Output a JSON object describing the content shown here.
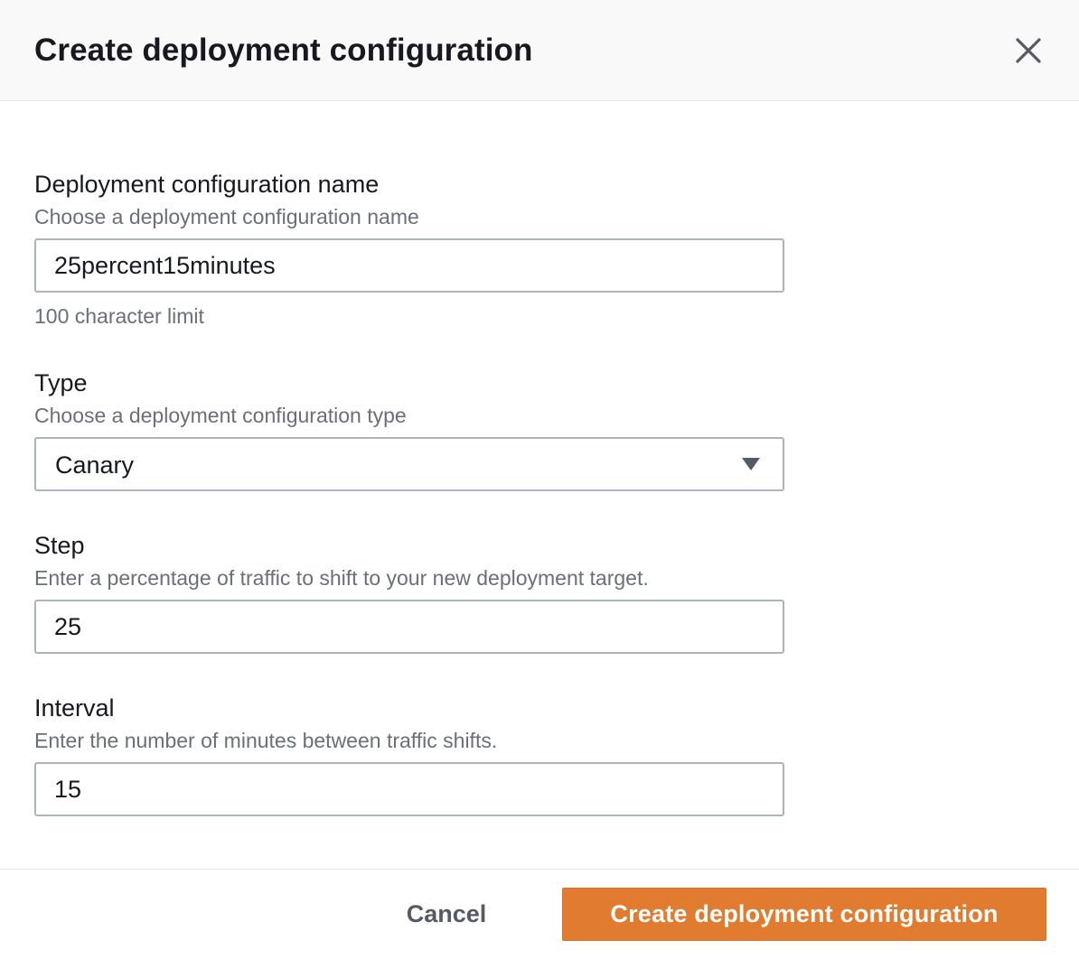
{
  "modal": {
    "title": "Create deployment configuration",
    "close_icon": "close-icon"
  },
  "fields": {
    "name": {
      "label": "Deployment configuration name",
      "description": "Choose a deployment configuration name",
      "value": "25percent15minutes",
      "hint": "100 character limit"
    },
    "type": {
      "label": "Type",
      "description": "Choose a deployment configuration type",
      "selected": "Canary",
      "caret_icon": "caret-down-icon"
    },
    "step": {
      "label": "Step",
      "description": "Enter a percentage of traffic to shift to your new deployment target.",
      "value": "25"
    },
    "interval": {
      "label": "Interval",
      "description": "Enter the number of minutes between traffic shifts.",
      "value": "15"
    }
  },
  "footer": {
    "cancel_label": "Cancel",
    "submit_label": "Create deployment configuration"
  },
  "colors": {
    "primary": "#e07b2f",
    "header_bg": "#f9f9f9",
    "border": "#aab7b8",
    "muted_text": "#687078"
  }
}
